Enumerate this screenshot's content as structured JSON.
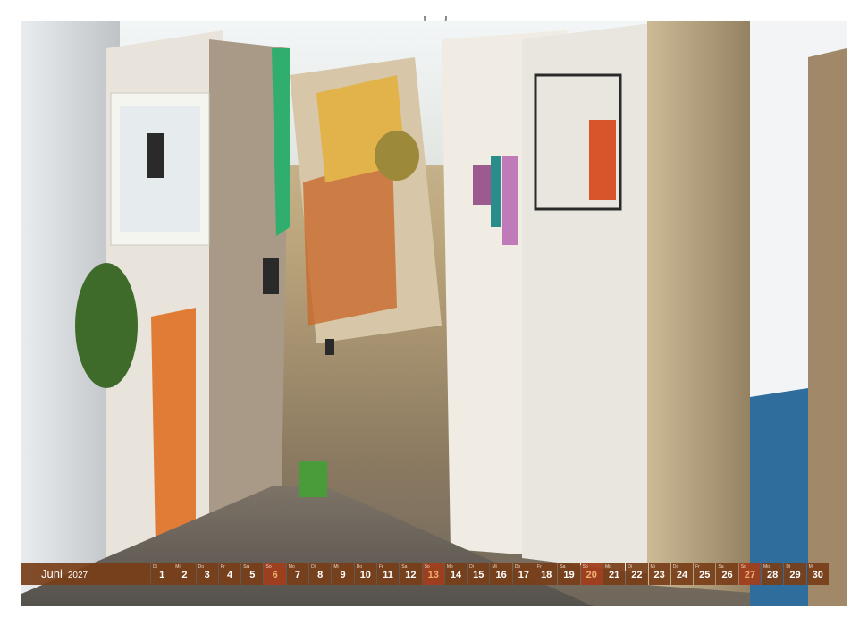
{
  "calendar": {
    "month": "Juni",
    "year": "2027",
    "days": [
      {
        "wd": "Di",
        "d": "1"
      },
      {
        "wd": "Mi",
        "d": "2"
      },
      {
        "wd": "Do",
        "d": "3"
      },
      {
        "wd": "Fr",
        "d": "4"
      },
      {
        "wd": "Sa",
        "d": "5"
      },
      {
        "wd": "So",
        "d": "6",
        "sun": true
      },
      {
        "wd": "Mo",
        "d": "7"
      },
      {
        "wd": "Di",
        "d": "8"
      },
      {
        "wd": "Mi",
        "d": "9"
      },
      {
        "wd": "Do",
        "d": "10"
      },
      {
        "wd": "Fr",
        "d": "11"
      },
      {
        "wd": "Sa",
        "d": "12"
      },
      {
        "wd": "So",
        "d": "13",
        "sun": true
      },
      {
        "wd": "Mo",
        "d": "14"
      },
      {
        "wd": "Di",
        "d": "15"
      },
      {
        "wd": "Mi",
        "d": "16"
      },
      {
        "wd": "Do",
        "d": "17"
      },
      {
        "wd": "Fr",
        "d": "18"
      },
      {
        "wd": "Sa",
        "d": "19"
      },
      {
        "wd": "So",
        "d": "20",
        "sun": true
      },
      {
        "wd": "Mo",
        "d": "21"
      },
      {
        "wd": "Di",
        "d": "22"
      },
      {
        "wd": "Mi",
        "d": "23"
      },
      {
        "wd": "Do",
        "d": "24"
      },
      {
        "wd": "Fr",
        "d": "25"
      },
      {
        "wd": "Sa",
        "d": "26"
      },
      {
        "wd": "So",
        "d": "27",
        "sun": true
      },
      {
        "wd": "Mo",
        "d": "28"
      },
      {
        "wd": "Di",
        "d": "29"
      },
      {
        "wd": "Mi",
        "d": "30"
      }
    ]
  },
  "colors": {
    "bar": "#783e18",
    "sunday": "#a03e1c",
    "sunday_text": "#f0b070"
  }
}
